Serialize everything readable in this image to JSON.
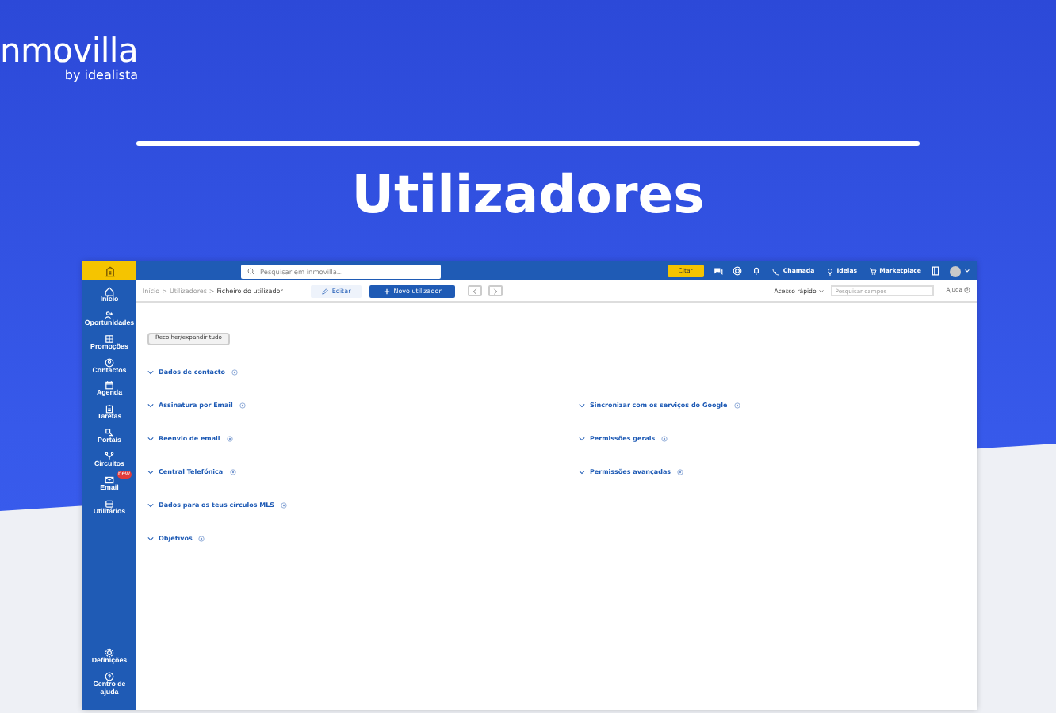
{
  "brand": {
    "logo": "nmovilla",
    "tagline": "by idealista"
  },
  "title": "Utilizadores",
  "app": {
    "search": {
      "placeholder": "Pesquisar em inmovilla..."
    },
    "topbar": {
      "quote_button": "Citar",
      "links": [
        {
          "label": "Chamada"
        },
        {
          "label": "Ideias"
        },
        {
          "label": "Marketplace"
        }
      ]
    },
    "sidebar": {
      "items": [
        {
          "label": "Início"
        },
        {
          "label": "Oportunidades"
        },
        {
          "label": "Promoções"
        },
        {
          "label": "Contactos"
        },
        {
          "label": "Agenda"
        },
        {
          "label": "Tarefas"
        },
        {
          "label": "Portais"
        },
        {
          "label": "Circuitos"
        },
        {
          "label": "Email",
          "badge": "new"
        },
        {
          "label": "Utilitários"
        }
      ],
      "bottom_items": [
        {
          "label": "Definições"
        },
        {
          "label": "Centro de ajuda"
        }
      ]
    },
    "breadcrumb": [
      {
        "kind": "link",
        "label": "Início"
      },
      {
        "kind": "separator",
        "label": ">"
      },
      {
        "kind": "link",
        "label": "Utilizadores"
      },
      {
        "kind": "separator",
        "label": ">"
      },
      {
        "kind": "current",
        "label": "Ficheiro do utilizador"
      }
    ],
    "edit_button": "Editar",
    "new_button": "Novo utilizador",
    "quick_access": "Acesso rápido",
    "field_search": {
      "placeholder": "Pesquisar campos"
    },
    "help": "Ajuda",
    "collapse_button": "Recolher/expandir tudo",
    "section_rows": [
      {
        "left": "Dados de contacto"
      },
      {
        "left": "Assinatura por Email",
        "right": "Sincronizar com os serviços do Google"
      },
      {
        "left": "Reenvio de email",
        "right": "Permissões gerais"
      },
      {
        "left": "Central Telefónica",
        "right": "Permissões avançadas"
      },
      {
        "left": "Dados para os teus círculos MLS"
      },
      {
        "left": "Objetivos"
      }
    ]
  }
}
